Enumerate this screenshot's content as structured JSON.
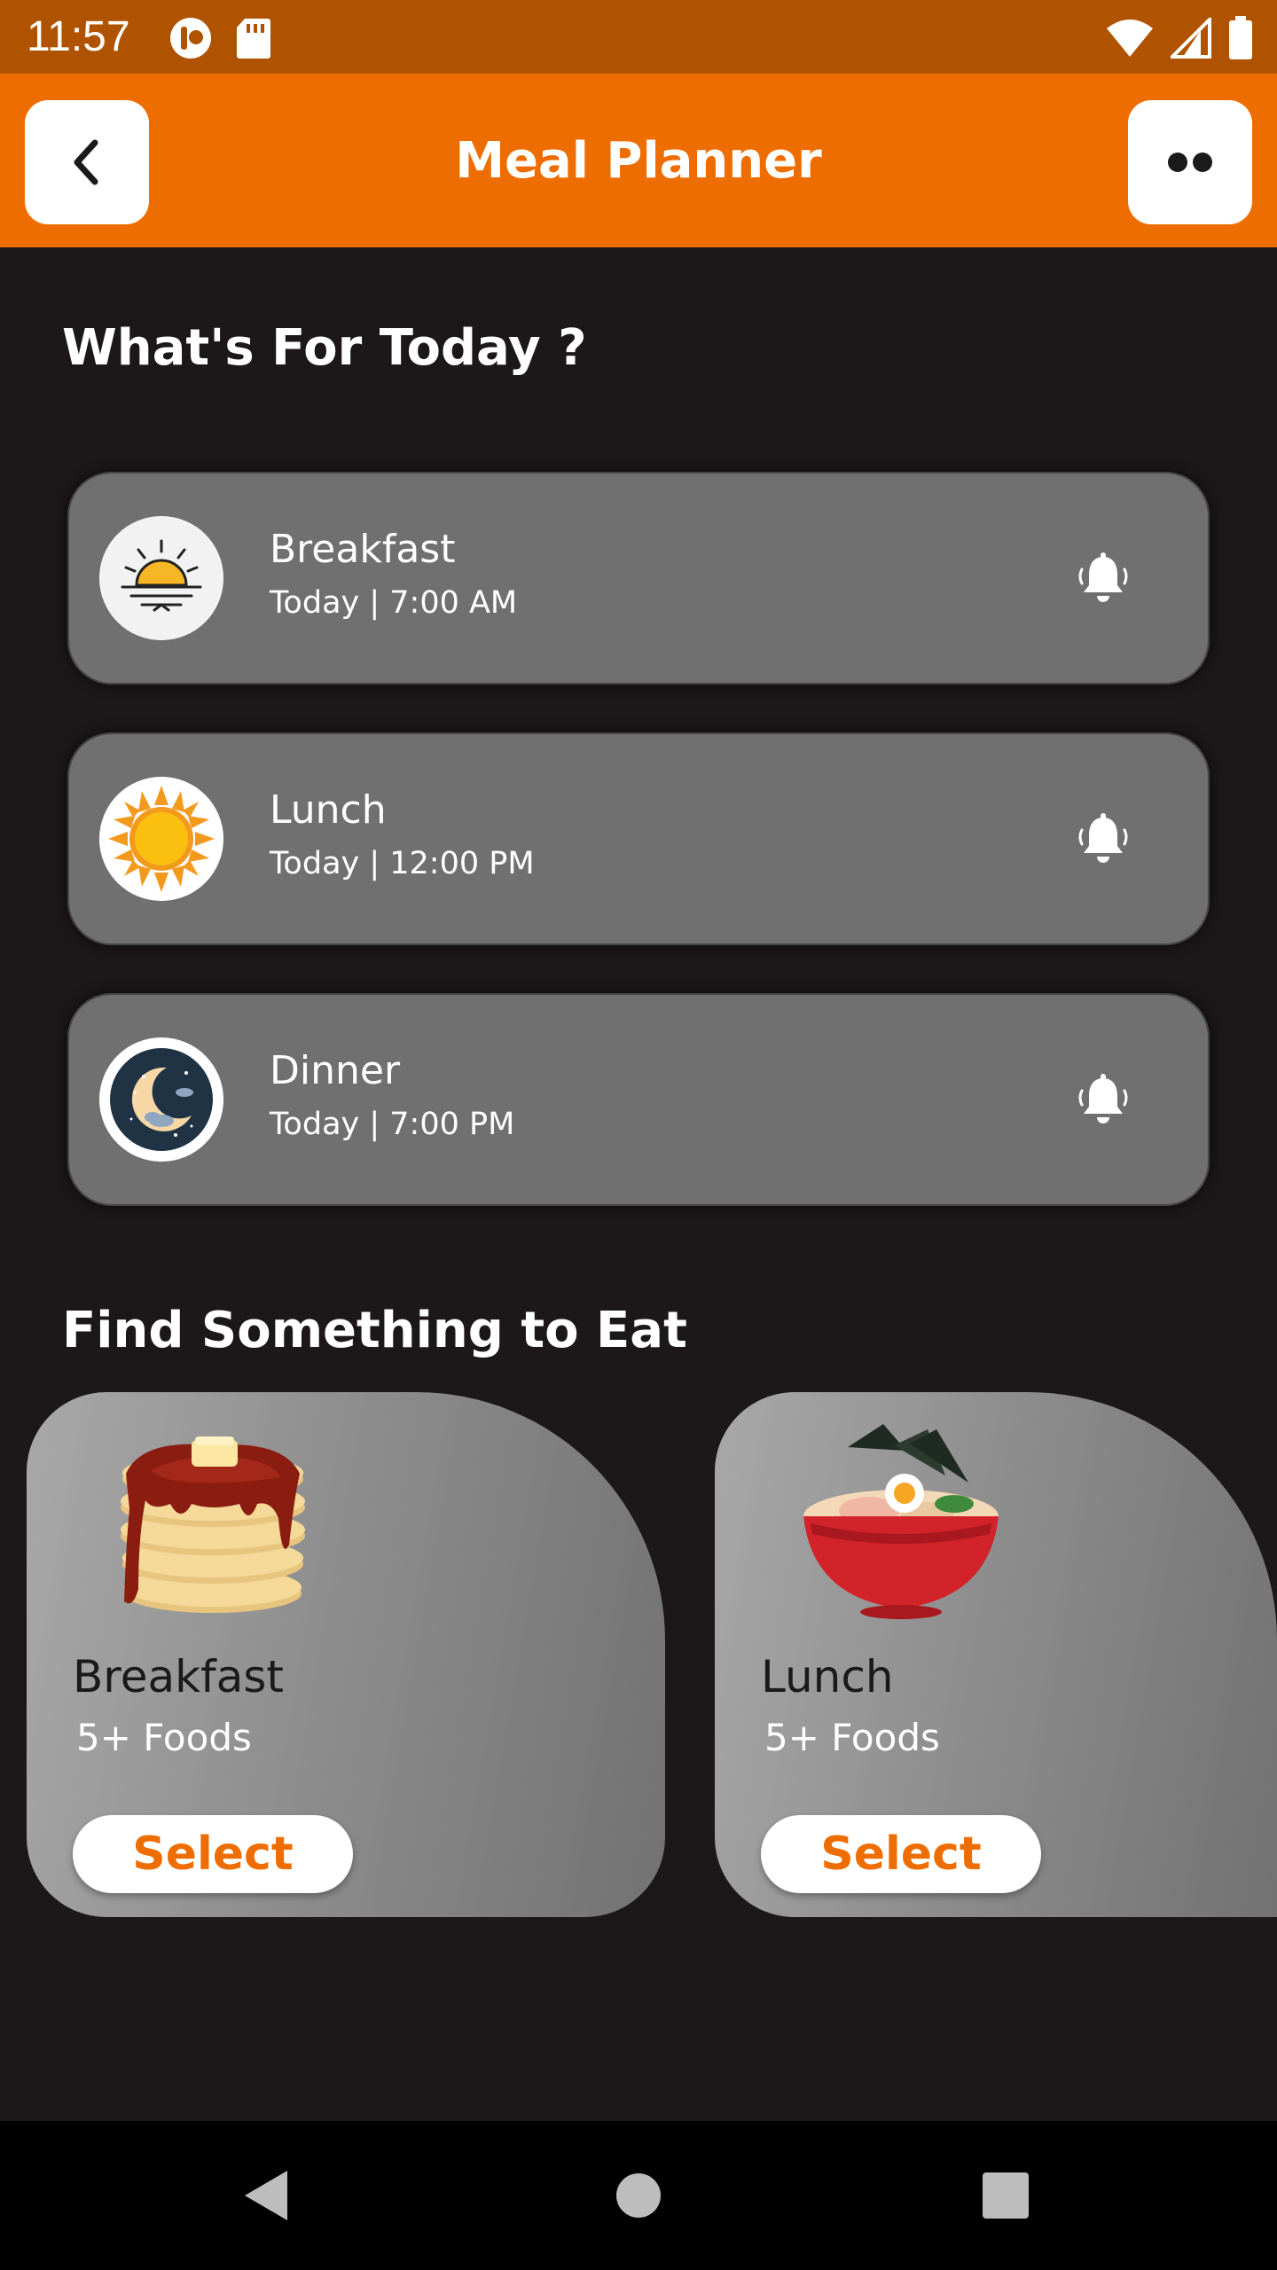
{
  "status_bar": {
    "time": "11:57"
  },
  "app_bar": {
    "title": "Meal Planner"
  },
  "today": {
    "title": "What's For Today ?",
    "meals": [
      {
        "name": "Breakfast",
        "time": "Today | 7:00 AM",
        "icon": "sunrise-icon"
      },
      {
        "name": "Lunch",
        "time": "Today | 12:00 PM",
        "icon": "sun-icon"
      },
      {
        "name": "Dinner",
        "time": "Today | 7:00 PM",
        "icon": "moon-icon"
      }
    ]
  },
  "find": {
    "title": "Find Something to Eat",
    "cards": [
      {
        "name": "Breakfast",
        "count": "5+ Foods",
        "button": "Select",
        "image": "pancakes-image"
      },
      {
        "name": "Lunch",
        "count": "5+ Foods",
        "button": "Select",
        "image": "ramen-bowl-image"
      }
    ]
  },
  "colors": {
    "accent": "#ee6d00",
    "status_bar": "#b05300",
    "background": "#1c1718",
    "card": "#707070"
  }
}
